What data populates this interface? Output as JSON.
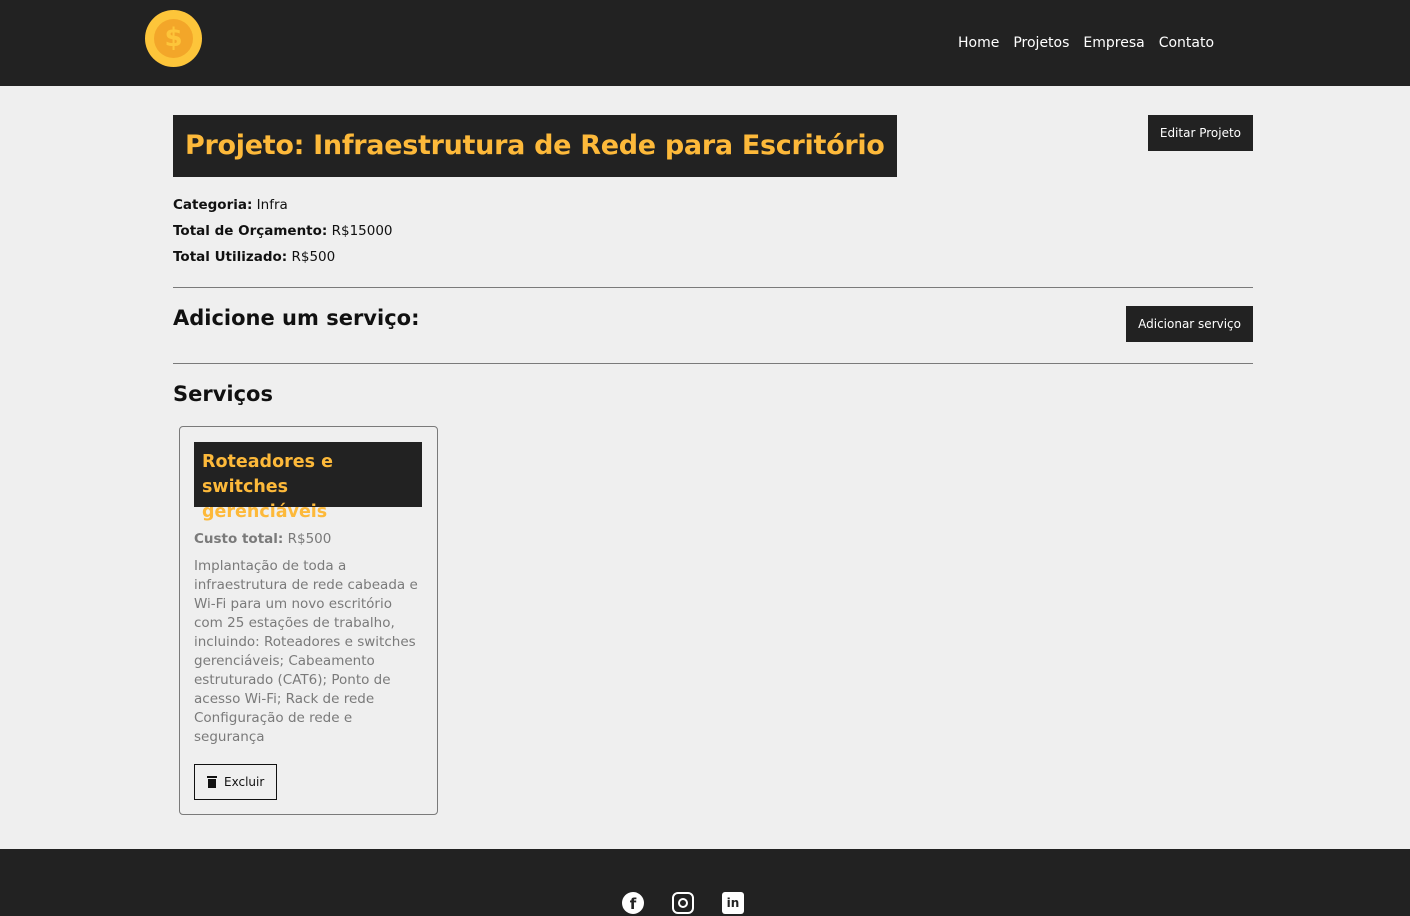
{
  "navbar": {
    "logo_glyph": "$",
    "links": [
      "Home",
      "Projetos",
      "Empresa",
      "Contato"
    ]
  },
  "project": {
    "title": "Projeto: Infraestrutura de Rede para Escritório",
    "edit_button": "Editar Projeto",
    "category_label": "Categoria:",
    "category_value": "Infra",
    "budget_label": "Total de Orçamento:",
    "budget_value": "R$15000",
    "used_label": "Total Utilizado:",
    "used_value": "R$500"
  },
  "add_service": {
    "heading": "Adicione um serviço:",
    "button": "Adicionar serviço"
  },
  "services": {
    "heading": "Serviços",
    "items": [
      {
        "title": "Roteadores e switches gerenciáveis",
        "cost_label": "Custo total:",
        "cost_value": "R$500",
        "description": "Implantação de toda a infraestrutura de rede cabeada e Wi-Fi para um novo escritório com 25 estações de trabalho, incluindo: Roteadores e switches gerenciáveis; Cabeamento estruturado (CAT6); Ponto de acesso Wi-Fi; Rack de rede Configuração de rede e segurança",
        "delete_button": "Excluir"
      }
    ]
  },
  "footer": {
    "social_icons": [
      "facebook-icon",
      "instagram-icon",
      "linkedin-icon"
    ],
    "facebook_glyph": "f",
    "linkedin_glyph": "in"
  },
  "colors": {
    "dark": "#222222",
    "accent": "#fdb93a",
    "background": "#efefef",
    "muted_text": "#7a7a7a"
  }
}
